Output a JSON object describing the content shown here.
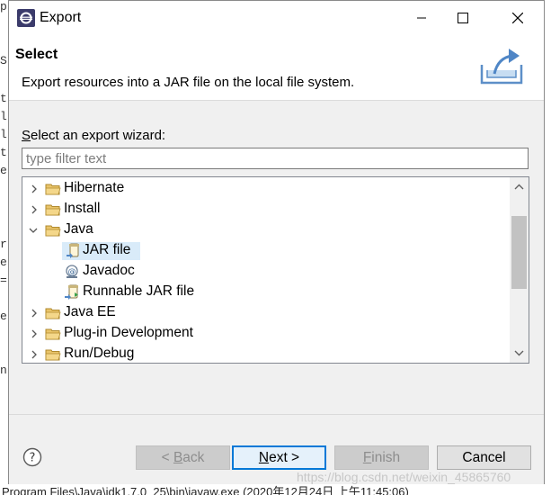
{
  "window": {
    "title": "Export",
    "controls": [
      "minimize",
      "maximize",
      "close"
    ]
  },
  "header": {
    "title": "Select",
    "description": "Export resources into a JAR file on the local file system.",
    "icon": "export-jar-icon"
  },
  "wizard": {
    "label": "Select an export wizard:",
    "label_mnemonic": "S",
    "label_rest": "elect an export wizard:",
    "filter_placeholder": "type filter text",
    "filter_value": ""
  },
  "tree": {
    "items": [
      {
        "label": "Hibernate",
        "level": 0,
        "expanded": false,
        "icon": "folder-icon"
      },
      {
        "label": "Install",
        "level": 0,
        "expanded": false,
        "icon": "folder-icon"
      },
      {
        "label": "Java",
        "level": 0,
        "expanded": true,
        "icon": "folder-icon"
      },
      {
        "label": "JAR file",
        "level": 1,
        "selected": true,
        "icon": "jar-file-icon"
      },
      {
        "label": "Javadoc",
        "level": 1,
        "icon": "javadoc-icon"
      },
      {
        "label": "Runnable JAR file",
        "level": 1,
        "icon": "runnable-jar-icon"
      },
      {
        "label": "Java EE",
        "level": 0,
        "expanded": false,
        "icon": "folder-icon"
      },
      {
        "label": "Plug-in Development",
        "level": 0,
        "expanded": false,
        "icon": "folder-icon"
      },
      {
        "label": "Run/Debug",
        "level": 0,
        "expanded": false,
        "icon": "folder-icon"
      }
    ]
  },
  "buttons": {
    "back": {
      "prefix": "< ",
      "mnemonic": "B",
      "rest": "ack",
      "enabled": false
    },
    "next": {
      "mnemonic": "N",
      "rest": "ext >",
      "enabled": true,
      "default": true
    },
    "finish": {
      "mnemonic": "F",
      "rest": "inish",
      "enabled": false
    },
    "cancel": {
      "label": "Cancel",
      "enabled": true
    }
  },
  "background": {
    "watermark": "https://blog.csdn.net/weixin_45865760",
    "status_text": "Program Files\\Java\\jdk1.7.0_25\\bin\\javaw.exe (2020年12月24日 上午11:45:06)",
    "left_fragments": [
      "p",
      "S",
      "t",
      "l",
      "l",
      "t",
      "e",
      "r",
      "e",
      "=",
      "e",
      "n"
    ]
  },
  "colors": {
    "selection": "#d9ebf9",
    "default_button_border": "#0078d7",
    "folder": "#dcb35c"
  }
}
